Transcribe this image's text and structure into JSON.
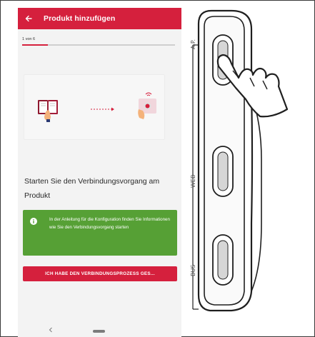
{
  "app": {
    "title": "Produkt hinzufügen",
    "back_icon": "arrow-left-icon"
  },
  "progress": {
    "label": "1 von 6",
    "current": 1,
    "total": 6
  },
  "instruction": {
    "heading": "Starten Sie den Verbindungsvorgang am Produkt"
  },
  "info": {
    "icon": "info-icon",
    "text": "In der Anleitung für die Konfiguration finden Sie Informationen wie Sie den Verbindungsvorgang starten"
  },
  "button": {
    "label": "ICH HABE DEN VERBINDUNGSPROZESS GES..."
  },
  "device": {
    "labels": {
      "ap": "A.P.",
      "web": "WEB",
      "bus": "BUS"
    }
  },
  "colors": {
    "brand_red": "#d5203d",
    "info_green": "#56a035",
    "screen_bg": "#f3f3f3"
  }
}
